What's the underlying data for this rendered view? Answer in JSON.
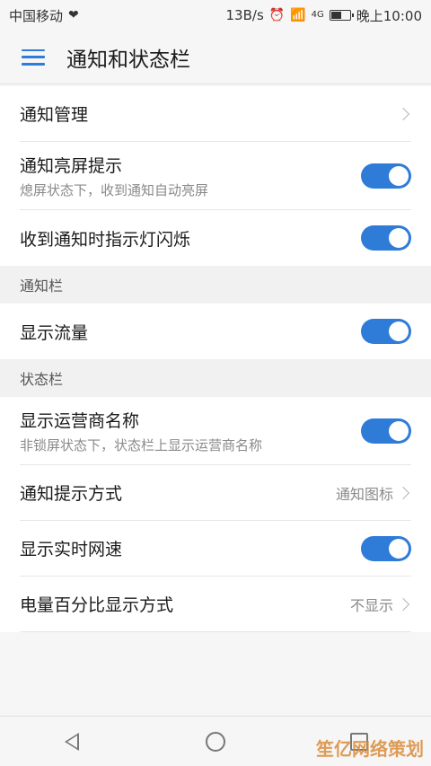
{
  "status_bar": {
    "carrier": "中国移动",
    "speed": "13B/s",
    "network": "4G",
    "time": "晚上10:00",
    "battery_level": 0.6
  },
  "app_bar": {
    "title": "通知和状态栏"
  },
  "settings": {
    "notification_management": "通知管理",
    "wake_screen": {
      "title": "通知亮屏提示",
      "subtitle": "熄屏状态下，收到通知自动亮屏",
      "enabled": true
    },
    "blink_light": {
      "title": "收到通知时指示灯闪烁",
      "enabled": true
    }
  },
  "section_notification_bar": {
    "header": "通知栏",
    "show_traffic": {
      "title": "显示流量",
      "enabled": true
    }
  },
  "section_status_bar": {
    "header": "状态栏",
    "carrier_name": {
      "title": "显示运营商名称",
      "subtitle": "非锁屏状态下，状态栏上显示运营商名称",
      "enabled": true
    },
    "notify_mode": {
      "title": "通知提示方式",
      "value": "通知图标"
    },
    "network_speed": {
      "title": "显示实时网速",
      "enabled": true
    },
    "battery_percent": {
      "title": "电量百分比显示方式",
      "value": "不显示"
    }
  },
  "watermark": "笙亿网络策划",
  "colors": {
    "accent": "#2e7bd8",
    "background": "#f6f6f6",
    "card": "#ffffff",
    "subtitle": "#8a8a8a"
  }
}
